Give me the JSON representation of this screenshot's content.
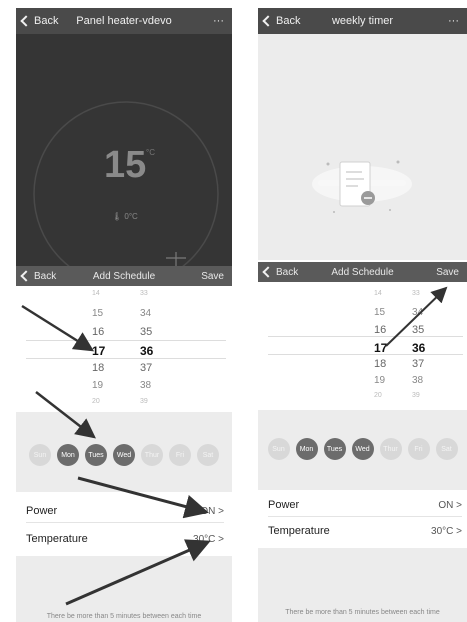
{
  "left": {
    "header": {
      "back_label": "Back",
      "title": "Panel heater-vdevo",
      "menu_label": "···"
    },
    "dial": {
      "value": "15",
      "unit": "°C",
      "sub": "0°C",
      "plus_label": "+"
    },
    "schedule_bar": {
      "back_label": "Back",
      "title": "Add Schedule",
      "save_label": "Save"
    },
    "picker": {
      "hours": [
        "14",
        "15",
        "16",
        "17",
        "18",
        "19",
        "20"
      ],
      "minutes": [
        "33",
        "34",
        "35",
        "36",
        "37",
        "38",
        "39"
      ]
    },
    "days": [
      {
        "label": "Sun",
        "on": false
      },
      {
        "label": "Mon",
        "on": true
      },
      {
        "label": "Tues",
        "on": true
      },
      {
        "label": "Wed",
        "on": true
      },
      {
        "label": "Thur",
        "on": false
      },
      {
        "label": "Fri",
        "on": false
      },
      {
        "label": "Sat",
        "on": false
      }
    ],
    "power": {
      "label": "Power",
      "value": "ON >"
    },
    "temperature": {
      "label": "Temperature",
      "value": "30°C >"
    },
    "note": "There be more than 5 minutes between each time"
  },
  "right": {
    "header": {
      "back_label": "Back",
      "title": "weekly timer",
      "menu_label": "···"
    },
    "schedule_bar": {
      "back_label": "Back",
      "title": "Add Schedule",
      "save_label": "Save"
    },
    "picker": {
      "hours": [
        "14",
        "15",
        "16",
        "17",
        "18",
        "19",
        "20"
      ],
      "minutes": [
        "33",
        "34",
        "35",
        "36",
        "37",
        "38",
        "39"
      ]
    },
    "days": [
      {
        "label": "Sun",
        "on": false
      },
      {
        "label": "Mon",
        "on": true
      },
      {
        "label": "Tues",
        "on": true
      },
      {
        "label": "Wed",
        "on": true
      },
      {
        "label": "Thur",
        "on": false
      },
      {
        "label": "Fri",
        "on": false
      },
      {
        "label": "Sat",
        "on": false
      }
    ],
    "power": {
      "label": "Power",
      "value": "ON >"
    },
    "temperature": {
      "label": "Temperature",
      "value": "30°C >"
    },
    "note": "There be more than 5 minutes between each time"
  },
  "colors": {
    "nav_bg": "#4a4a4a",
    "dark_panel": "#3a3a3a",
    "light_panel": "#ececec",
    "day_on": "#6c6c6c",
    "day_off": "#d8d8d8"
  }
}
